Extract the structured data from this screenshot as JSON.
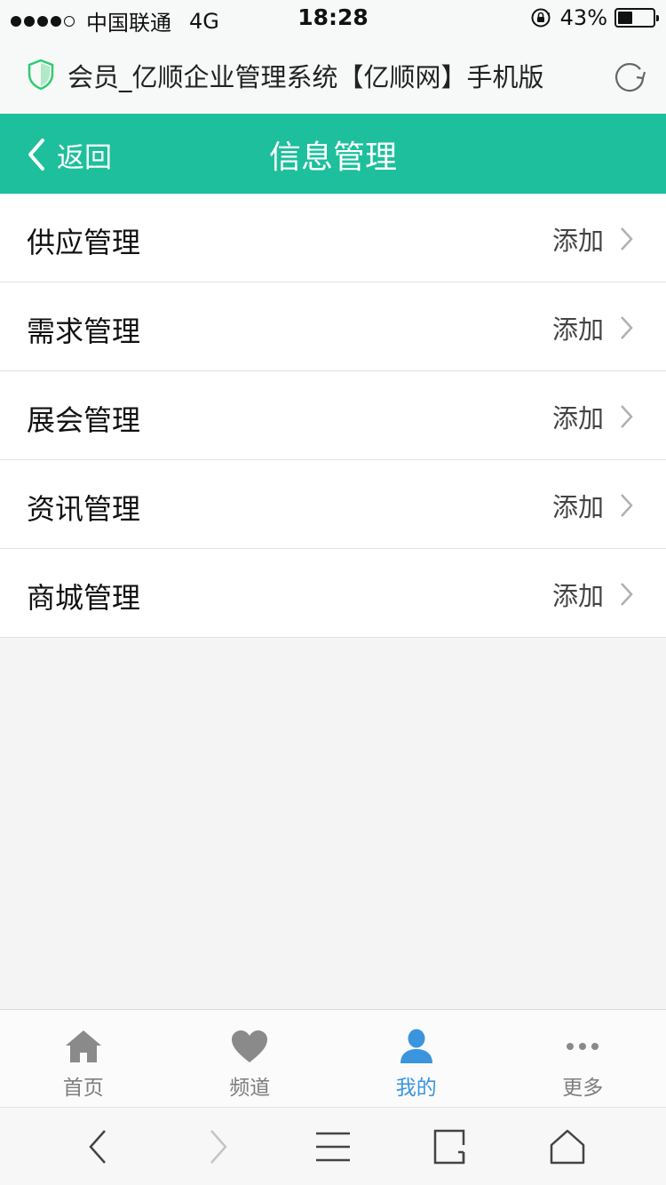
{
  "status_bar": {
    "carrier": "中国联通",
    "network": "4G",
    "time": "18:28",
    "battery_percent": "43%",
    "battery_level": 0.43,
    "signal_bars_filled": 4,
    "signal_bars_total": 5
  },
  "browser": {
    "page_title": "会员_亿顺企业管理系统【亿顺网】手机版",
    "shield_color": "#2ecc71"
  },
  "header": {
    "back_label": "返回",
    "title": "信息管理",
    "bg_color": "#1dbf9c"
  },
  "menu": {
    "items": [
      {
        "label": "供应管理",
        "action": "添加"
      },
      {
        "label": "需求管理",
        "action": "添加"
      },
      {
        "label": "展会管理",
        "action": "添加"
      },
      {
        "label": "资讯管理",
        "action": "添加"
      },
      {
        "label": "商城管理",
        "action": "添加"
      }
    ]
  },
  "tabbar": {
    "active_color": "#3a95de",
    "items": [
      {
        "label": "首页",
        "icon": "home-icon"
      },
      {
        "label": "频道",
        "icon": "heart-icon"
      },
      {
        "label": "我的",
        "icon": "user-icon",
        "active": true
      },
      {
        "label": "更多",
        "icon": "more-icon"
      }
    ]
  },
  "toolbar": {
    "icons": [
      "back-arrow-icon",
      "forward-arrow-icon",
      "menu-icon",
      "tabs-icon",
      "home-outline-icon"
    ]
  }
}
